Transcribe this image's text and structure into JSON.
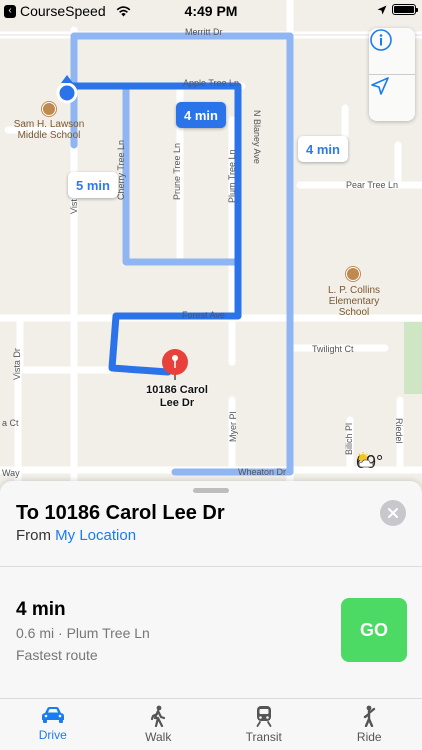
{
  "status": {
    "app_name": "CourseSpeed",
    "time": "4:49 PM"
  },
  "map": {
    "streets": {
      "merritt": "Merritt Dr",
      "apple_tree": "Apple Tree Ln",
      "n_blaney": "N Blaney Ave",
      "cherry_tree": "Cherry Tree Ln",
      "prune_tree": "Prune Tree Ln",
      "plum_tree": "Plum Tree Ln",
      "pear_tree": "Pear Tree Ln",
      "forest": "Forest Ave",
      "twilight": "Twilight Ct",
      "vista": "Vista Dr",
      "vista_top": "Vist",
      "ct_left": "a Ct",
      "way_left": "Way",
      "myer": "Myer Pl",
      "bilich": "Bilich Pl",
      "riedel": "Riedel",
      "wheaton": "Wheaton Dr"
    },
    "pois": {
      "lawson": "Sam H. Lawson\nMiddle School",
      "collins": "L. P. Collins\nElementary\nSchool"
    },
    "destination_label": "10186 Carol\nLee Dr",
    "bubbles": {
      "selected": "4 min",
      "alt_right": "4 min",
      "alt_left": "5 min"
    },
    "weather": {
      "icon": "partly-sunny-icon",
      "temp": "69°"
    }
  },
  "panel": {
    "title": "To 10186 Carol Lee Dr",
    "from_prefix": "From ",
    "from_link": "My Location",
    "route_time": "4 min",
    "route_detail": "0.6 mi · Plum Tree Ln",
    "route_note": "Fastest route",
    "go_label": "GO"
  },
  "tabs": [
    {
      "label": "Drive",
      "icon": "car-icon",
      "active": true
    },
    {
      "label": "Walk",
      "icon": "walk-icon",
      "active": false
    },
    {
      "label": "Transit",
      "icon": "train-icon",
      "active": false
    },
    {
      "label": "Ride",
      "icon": "ride-icon",
      "active": false
    }
  ],
  "colors": {
    "route_main": "#2a73e8",
    "route_alt": "#8fb6f2",
    "go": "#4cd964",
    "link": "#1a7cf2"
  }
}
